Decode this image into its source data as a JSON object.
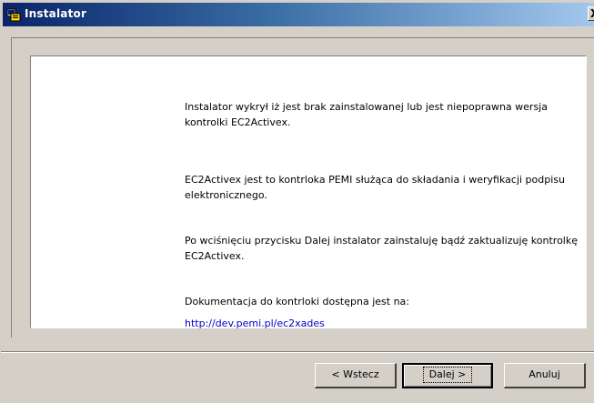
{
  "window": {
    "title": "Instalator",
    "close_glyph": "X",
    "icon": "installer-icon"
  },
  "panel": {
    "paragraphs": [
      "Instalator wykrył iż jest brak zainstalowanej lub jest niepoprawna wersja kontrolki  EC2Activex.",
      "EC2Activex jest to kontrloka  PEMI służąca do składania i weryfikacji podpisu elektronicznego.",
      "Po wciśnięciu przycisku Dalej instalator zainstaluję bądź zaktualizuję kontrolkę EC2Activex.",
      "Dokumentacja do kontrloki dostępna jest na:"
    ],
    "link": "http://dev.pemi.pl/ec2xades"
  },
  "buttons": {
    "back": "< Wstecz",
    "next": "Dalej >",
    "cancel": "Anuluj"
  },
  "colors": {
    "title_bar_start": "#0a246a",
    "title_bar_end": "#a6caf0",
    "dialog_face": "#d4d0c8",
    "link": "#0000cc"
  }
}
